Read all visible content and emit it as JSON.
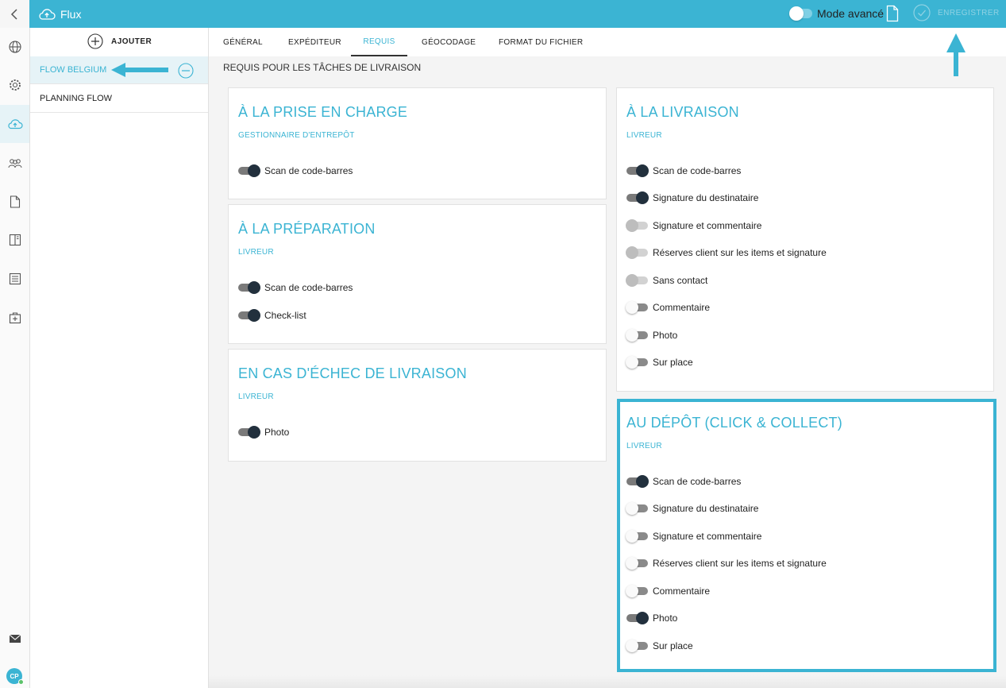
{
  "header": {
    "title": "Flux",
    "mode_label": "Mode avancé",
    "save_label": "ENREGISTRER",
    "accent": "#3bb4d3"
  },
  "sidebar": {
    "icons": [
      "globe-icon",
      "gear-icon",
      "cloud-upload-icon",
      "users-icon",
      "document-icon",
      "book-icon",
      "list-icon",
      "medical-kit-icon",
      "mail-icon"
    ],
    "avatar_initials": "CP"
  },
  "flows": {
    "add_label": "AJOUTER",
    "items": [
      {
        "label": "FLOW BELGIUM"
      },
      {
        "label": "PLANNING FLOW"
      }
    ]
  },
  "tabs": [
    {
      "label": "GÉNÉRAL"
    },
    {
      "label": "EXPÉDITEUR"
    },
    {
      "label": "REQUIS"
    },
    {
      "label": "GÉOCODAGE"
    },
    {
      "label": "FORMAT DU FICHIER"
    }
  ],
  "section_title": "REQUIS POUR LES TÂCHES DE LIVRAISON",
  "cards": {
    "pickup": {
      "title": "À LA PRISE EN CHARGE",
      "role": "GESTIONNAIRE D'ENTREPÔT",
      "options": [
        {
          "label": "Scan de code-barres",
          "state": "on"
        }
      ]
    },
    "preparation": {
      "title": "À LA PRÉPARATION",
      "role": "LIVREUR",
      "options": [
        {
          "label": "Scan de code-barres",
          "state": "on"
        },
        {
          "label": "Check-list",
          "state": "on"
        }
      ]
    },
    "failure": {
      "title": "EN CAS D'ÉCHEC DE LIVRAISON",
      "role": "LIVREUR",
      "options": [
        {
          "label": "Photo",
          "state": "on"
        }
      ]
    },
    "delivery": {
      "title": "À LA LIVRAISON",
      "role": "LIVREUR",
      "options": [
        {
          "label": "Scan de code-barres",
          "state": "on"
        },
        {
          "label": "Signature du destinataire",
          "state": "on"
        },
        {
          "label": "Signature et commentaire",
          "state": "disabled"
        },
        {
          "label": "Réserves client sur les items et signature",
          "state": "disabled"
        },
        {
          "label": "Sans contact",
          "state": "disabled"
        },
        {
          "label": "Commentaire",
          "state": "off"
        },
        {
          "label": "Photo",
          "state": "off"
        },
        {
          "label": "Sur place",
          "state": "off"
        }
      ]
    },
    "depot": {
      "title": "AU DÉPÔT (CLICK & COLLECT)",
      "role": "LIVREUR",
      "options": [
        {
          "label": "Scan de code-barres",
          "state": "on"
        },
        {
          "label": "Signature du destinataire",
          "state": "off"
        },
        {
          "label": "Signature et commentaire",
          "state": "off"
        },
        {
          "label": "Réserves client sur les items et signature",
          "state": "off"
        },
        {
          "label": "Commentaire",
          "state": "off"
        },
        {
          "label": "Photo",
          "state": "on"
        },
        {
          "label": "Sur place",
          "state": "off"
        }
      ]
    }
  }
}
